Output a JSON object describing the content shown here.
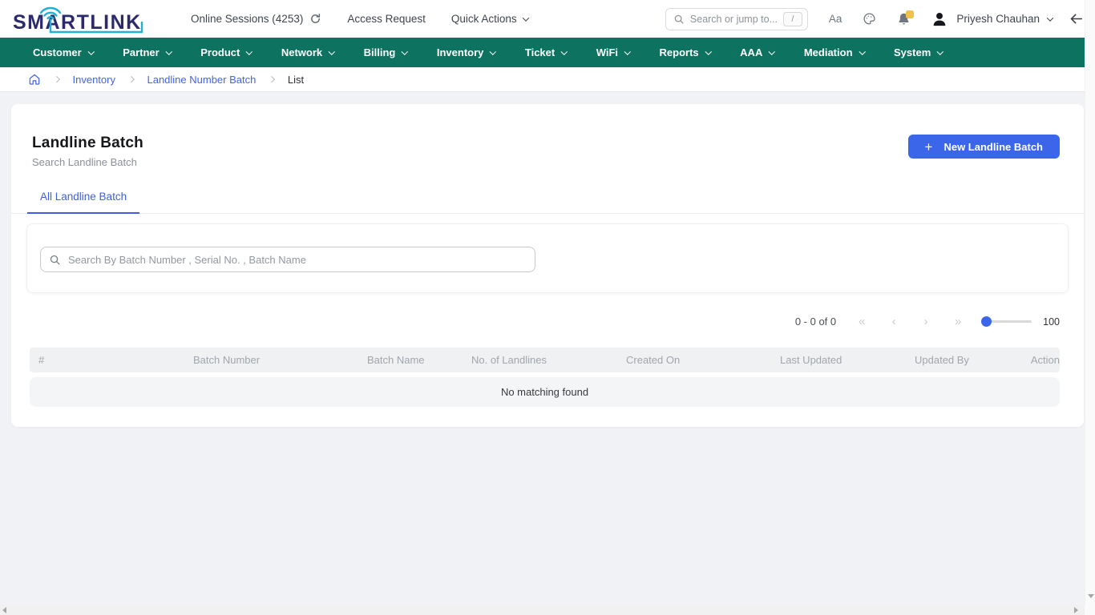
{
  "header": {
    "logo_text": "SMARTLINK",
    "online_sessions_label": "Online Sessions (4253)",
    "access_request_label": "Access Request",
    "quick_actions_label": "Quick Actions",
    "search_placeholder": "Search or jump to...",
    "search_shortcut": "/",
    "font_size_label": "Aa",
    "user_name": "Priyesh Chauhan",
    "icons": {
      "refresh": "circular-refresh-arrow",
      "search": "magnifier",
      "theme": "palette",
      "notifications": "bell-with-yellow-badge",
      "avatar": "person-silhouette",
      "dropdown": "chevron-down",
      "back": "left-arrow"
    }
  },
  "navbar": {
    "items": [
      "Customer",
      "Partner",
      "Product",
      "Network",
      "Billing",
      "Inventory",
      "Ticket",
      "WiFi",
      "Reports",
      "AAA",
      "Mediation",
      "System"
    ]
  },
  "breadcrumb": {
    "home_icon": "house",
    "links": [
      "Inventory",
      "Landline Number Batch"
    ],
    "current": "List"
  },
  "page": {
    "title": "Landline Batch",
    "subtitle": "Search Landline Batch",
    "new_batch_button": "New Landline Batch",
    "active_tab": "All Landline Batch",
    "filter_search_placeholder": "Search By Batch Number , Serial No. , Batch Name",
    "pagination": {
      "range_text": "0 - 0 of 0",
      "first": "«",
      "prev": "‹",
      "next": "›",
      "last": "»",
      "page_size": "100"
    },
    "table": {
      "columns": [
        "#",
        "Batch Number",
        "Batch Name",
        "No. of Landlines",
        "Created On",
        "Last Updated",
        "Updated By",
        "Action"
      ],
      "empty_text": "No matching found"
    }
  },
  "colors": {
    "navbar_green": "#0e7260",
    "primary_blue": "#3c66e9",
    "link_blue": "#4263eb",
    "logo_navy": "#2b2a6b",
    "logo_cyan": "#23b0d4",
    "page_background": "#f1f2f5"
  }
}
